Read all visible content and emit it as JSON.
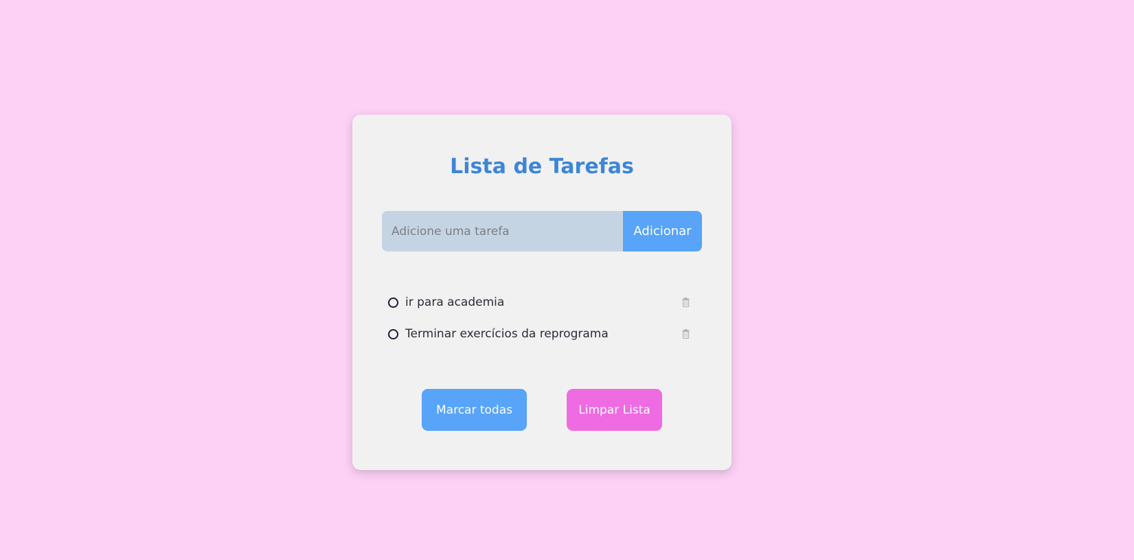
{
  "app": {
    "title": "Lista de Tarefas"
  },
  "input": {
    "placeholder": "Adicione uma tarefa",
    "value": "",
    "add_label": "Adicionar"
  },
  "tasks": [
    {
      "text": "ir para academia",
      "done": false
    },
    {
      "text": "Terminar exercícios da reprograma",
      "done": false
    }
  ],
  "actions": {
    "mark_all_label": "Marcar todas",
    "clear_label": "Limpar Lista"
  },
  "icons": {
    "checkbox": "circle-outline-icon",
    "delete": "trash-icon"
  },
  "colors": {
    "background": "#fdd1f6",
    "card": "#f1f1f1",
    "title": "#3d86d6",
    "primary_button": "#57a4f9",
    "clear_button": "#ef6be2",
    "input": "#c5d4e3"
  }
}
